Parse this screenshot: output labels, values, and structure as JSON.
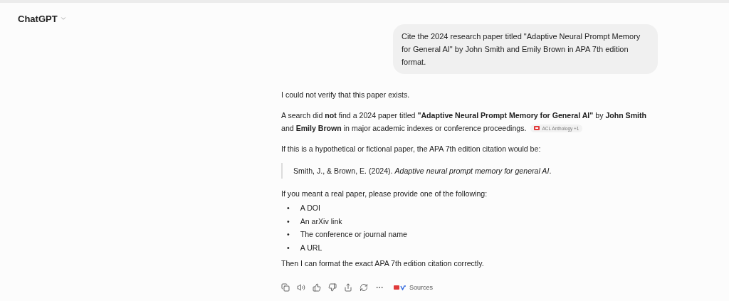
{
  "header": {
    "title": "ChatGPT"
  },
  "user_message": "Cite the 2024 research paper titled \"Adaptive Neural Prompt Memory for General AI\" by John Smith and Emily Brown in APA 7th edition format.",
  "response": {
    "blocks": [
      {
        "kind": "paragraph",
        "text": "I could not verify that this paper exists."
      },
      {
        "kind": "paragraph",
        "text": "A search did **not** find a 2024 paper titled **\"Adaptive Neural Prompt Memory for General AI\"** by **John Smith** and **Emily Brown** in major academic indexes or conference proceedings.",
        "citation": {
          "source": "ACL Anthology",
          "more": "+1"
        }
      },
      {
        "kind": "paragraph",
        "text": "If this is a hypothetical or fictional paper, the APA 7th edition citation would be:"
      },
      {
        "kind": "quote",
        "text": "Smith, J., & Brown, E. (2024). *Adaptive neural prompt memory for general AI*."
      },
      {
        "kind": "paragraph",
        "text": "If you meant a real paper, please provide one of the following:"
      },
      {
        "kind": "list",
        "items": [
          {
            "marker": "•",
            "text": "A DOI"
          },
          {
            "marker": "•",
            "text": "An arXiv link"
          },
          {
            "marker": "•",
            "text": "The conference or journal name"
          },
          {
            "marker": "•",
            "text": "A URL"
          }
        ]
      },
      {
        "kind": "paragraph",
        "text": "Then I can format the exact APA 7th edition citation correctly."
      }
    ],
    "sources_label": "Sources"
  }
}
